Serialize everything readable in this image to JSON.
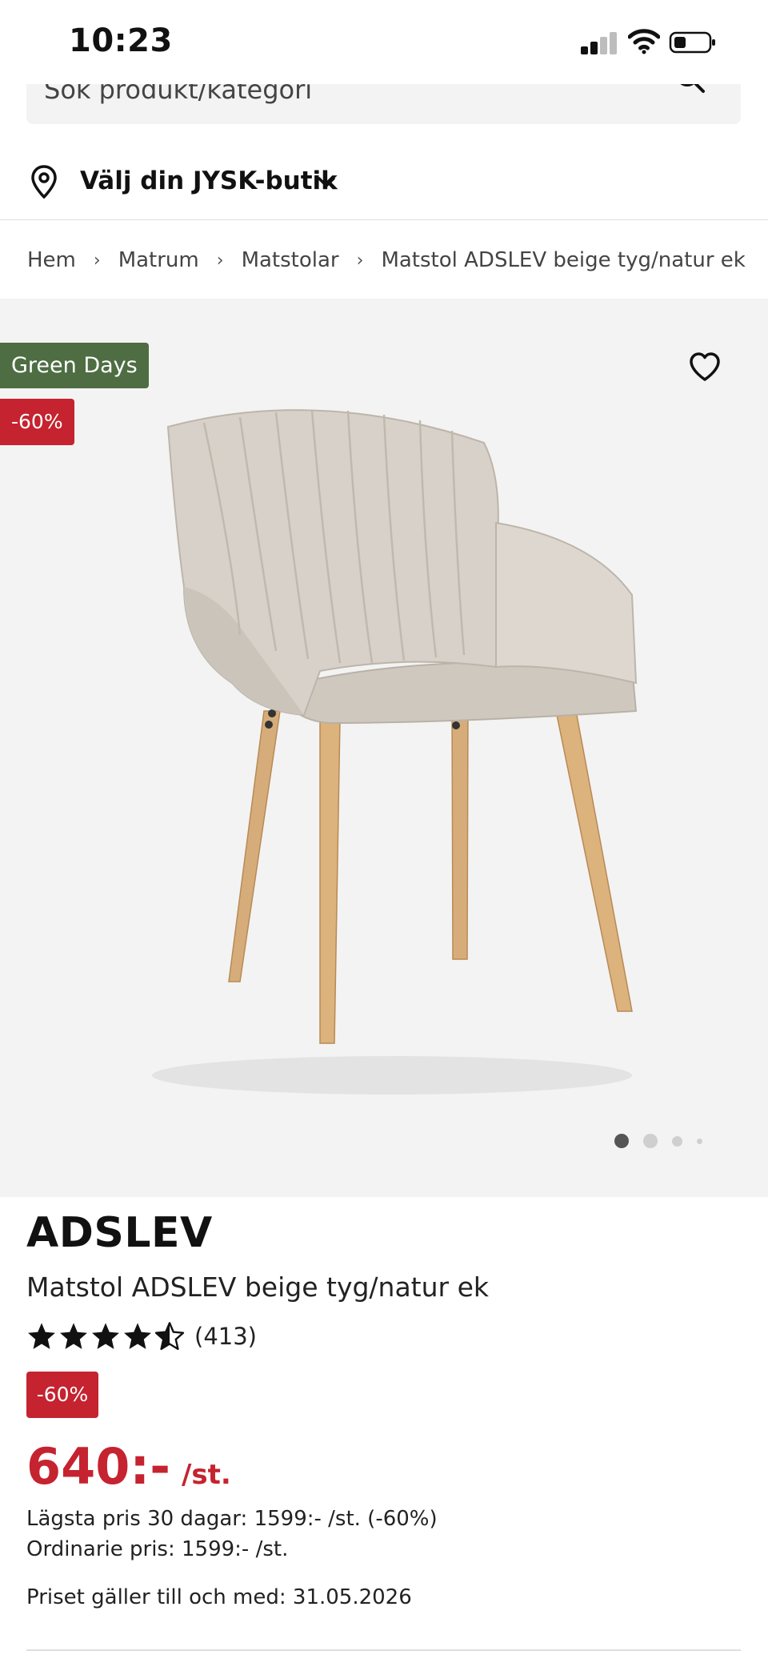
{
  "status_bar": {
    "time": "10:23"
  },
  "search": {
    "placeholder": "Sök produkt/kategori"
  },
  "store": {
    "label": "Välj din JYSK-butik"
  },
  "breadcrumb": [
    "Hem",
    "Matrum",
    "Matstolar",
    "Matstol ADSLEV beige tyg/natur ek"
  ],
  "gallery": {
    "badges": {
      "campaign": "Green Days",
      "discount": "-60%"
    },
    "image_count": 4,
    "active_image": 1
  },
  "product": {
    "brand": "ADSLEV",
    "name": "Matstol ADSLEV beige tyg/natur ek",
    "rating": {
      "stars": 4.5,
      "count": "(413)"
    },
    "discount_badge": "-60%",
    "price": "640:-",
    "price_unit": "/st.",
    "lowest_price_30_days": "Lägsta pris 30 dagar: 1599:- /st. (-60%)",
    "ordinary_price": "Ordinarie pris: 1599:- /st.",
    "valid_until": "Priset gäller till och med: 31.05.2026"
  },
  "colors": {
    "accent_red": "#c5232f",
    "green_days": "#4e6d43",
    "gallery_bg": "#f3f3f3"
  }
}
